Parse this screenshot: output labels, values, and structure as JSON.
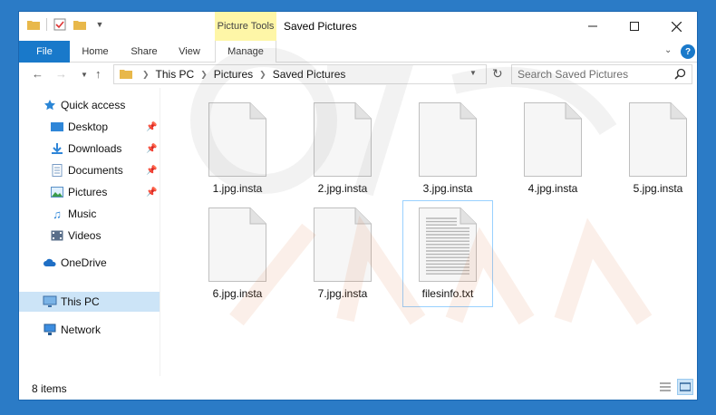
{
  "window": {
    "title": "Saved Pictures",
    "contextual_tab": "Picture Tools"
  },
  "ribbon": {
    "tabs": [
      "File",
      "Home",
      "Share",
      "View",
      "Manage"
    ]
  },
  "address": {
    "crumbs": [
      "This PC",
      "Pictures",
      "Saved Pictures"
    ]
  },
  "search": {
    "placeholder": "Search Saved Pictures"
  },
  "nav": {
    "quick_access": "Quick access",
    "items": [
      "Desktop",
      "Downloads",
      "Documents",
      "Pictures",
      "Music",
      "Videos"
    ],
    "onedrive": "OneDrive",
    "this_pc": "This PC",
    "network": "Network"
  },
  "files": [
    {
      "name": "1.jpg.insta",
      "kind": "blank"
    },
    {
      "name": "2.jpg.insta",
      "kind": "blank"
    },
    {
      "name": "3.jpg.insta",
      "kind": "blank"
    },
    {
      "name": "4.jpg.insta",
      "kind": "blank"
    },
    {
      "name": "5.jpg.insta",
      "kind": "blank"
    },
    {
      "name": "6.jpg.insta",
      "kind": "blank"
    },
    {
      "name": "7.jpg.insta",
      "kind": "blank"
    },
    {
      "name": "filesinfo.txt",
      "kind": "text"
    }
  ],
  "status": {
    "count": "8 items"
  },
  "colors": {
    "file_tab": "#1979ca",
    "context_tab": "#fef6a7",
    "selection": "#cce4f7",
    "folder": "#e8b84a"
  }
}
